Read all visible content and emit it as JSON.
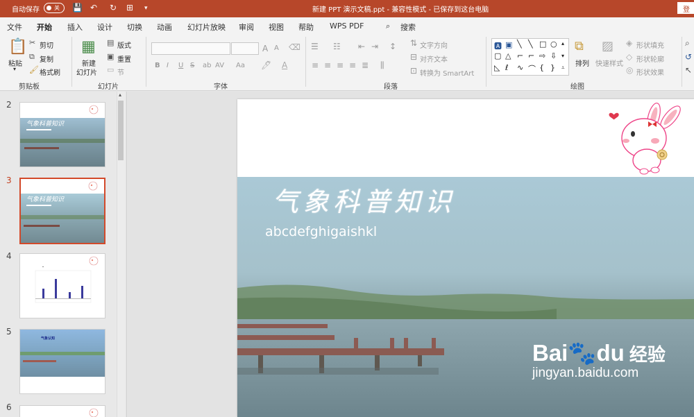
{
  "titlebar": {
    "autosave_label": "自动保存",
    "autosave_state": "关",
    "document_title": "新建 PPT 演示文稿.ppt  -  兼容性模式 - 已保存到这台电脑",
    "signin_label": "登录"
  },
  "tabs": [
    "文件",
    "开始",
    "插入",
    "设计",
    "切换",
    "动画",
    "幻灯片放映",
    "审阅",
    "视图",
    "帮助",
    "WPS PDF"
  ],
  "active_tab": "开始",
  "search_label": "搜索",
  "ribbon": {
    "clipboard": {
      "paste": "粘贴",
      "cut": "剪切",
      "copy": "复制",
      "format_painter": "格式刷",
      "label": "剪贴板"
    },
    "slides": {
      "new_slide": "新建",
      "new_slide2": "幻灯片",
      "layout": "版式",
      "reset": "重置",
      "section": "节",
      "label": "幻灯片"
    },
    "font": {
      "label": "字体",
      "bold": "B",
      "italic": "I",
      "underline": "U",
      "strike": "S",
      "shadow": "ab",
      "spacing": "AV",
      "case": "Aa",
      "grow": "A",
      "shrink": "A"
    },
    "paragraph": {
      "label": "段落",
      "text_direction": "文字方向",
      "align_text": "对齐文本",
      "smartart": "转换为 SmartArt"
    },
    "drawing": {
      "label": "绘图",
      "arrange": "排列",
      "quick_styles": "快速样式",
      "shape_fill": "形状填充",
      "shape_outline": "形状轮廓",
      "shape_effects": "形状效果"
    }
  },
  "thumbnails": [
    {
      "num": "2",
      "selected": false,
      "kind": "photo-title"
    },
    {
      "num": "3",
      "selected": true,
      "kind": "photo-title"
    },
    {
      "num": "4",
      "selected": false,
      "kind": "chart"
    },
    {
      "num": "5",
      "selected": false,
      "kind": "photo-small",
      "caption": "气象认知"
    },
    {
      "num": "6",
      "selected": false,
      "kind": "blank"
    }
  ],
  "slide": {
    "title": "气象科普知识",
    "subtitle": "abcdefghigaishkl"
  },
  "watermark": {
    "brand": "Bai",
    "brand2": "du",
    "cn": "经验",
    "url": "jingyan.baidu.com"
  },
  "colors": {
    "accent": "#b7472a",
    "selected_thumb": "#d2492a"
  }
}
